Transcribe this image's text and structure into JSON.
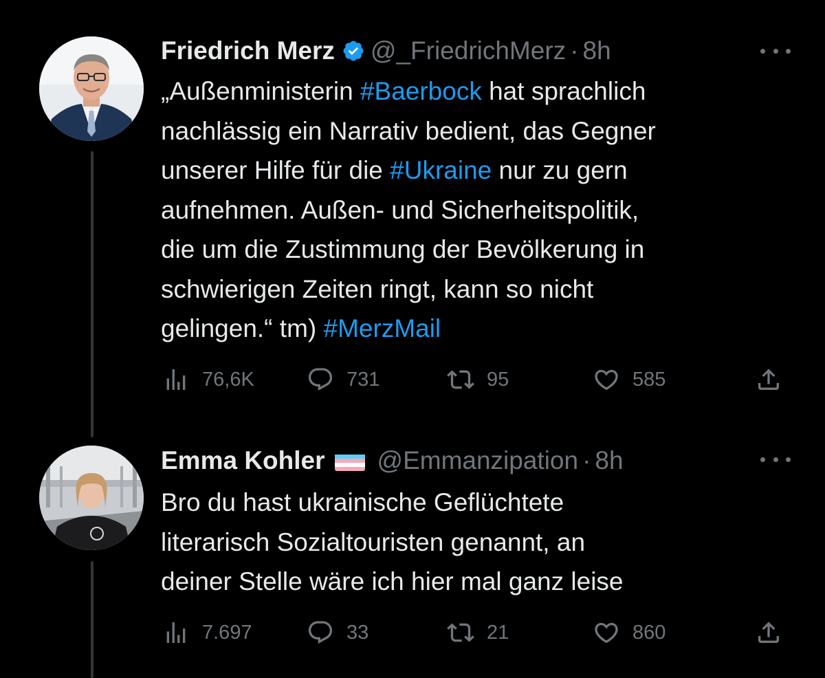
{
  "tweets": [
    {
      "author": {
        "name": "Friedrich Merz",
        "handle": "@_FriedrichMerz",
        "verified": true
      },
      "time": "8h",
      "text_lines": [
        [
          {
            "t": "„Außenministerin "
          },
          {
            "t": "#Baerbock",
            "tag": true
          },
          {
            "t": " hat sprachlich"
          }
        ],
        [
          {
            "t": "nachlässig ein Narrativ bedient, das Gegner"
          }
        ],
        [
          {
            "t": "unserer Hilfe für die "
          },
          {
            "t": "#Ukraine",
            "tag": true
          },
          {
            "t": " nur zu gern"
          }
        ],
        [
          {
            "t": "aufnehmen. Außen- und Sicherheitspolitik,"
          }
        ],
        [
          {
            "t": "die um die Zustimmung der Bevölkerung in"
          }
        ],
        [
          {
            "t": "schwierigen Zeiten ringt, kann so nicht"
          }
        ],
        [
          {
            "t": "gelingen.“ tm) "
          },
          {
            "t": "#MerzMail",
            "tag": true
          }
        ]
      ],
      "stats": {
        "views": "76,6K",
        "replies": "731",
        "retweets": "95",
        "likes": "585"
      }
    },
    {
      "author": {
        "name": "Emma Kohler",
        "handle": "@Emmanzipation",
        "flag": "transgender-flag"
      },
      "time": "8h",
      "text_lines": [
        [
          {
            "t": "Bro du hast ukrainische Geflüchtete"
          }
        ],
        [
          {
            "t": "literarisch Sozialtouristen genannt, an"
          }
        ],
        [
          {
            "t": "deiner Stelle wäre ich hier mal ganz leise"
          }
        ]
      ],
      "stats": {
        "views": "7.697",
        "replies": "33",
        "retweets": "21",
        "likes": "860"
      }
    }
  ],
  "separator": "·",
  "icons": {
    "views": "views-icon",
    "reply": "reply-icon",
    "retweet": "retweet-icon",
    "like": "like-icon",
    "share": "share-icon",
    "more": "more-icon",
    "verified": "verified-badge-icon"
  },
  "colors": {
    "background": "#000000",
    "text": "#e7e9ea",
    "muted": "#71767b",
    "hashtag": "#1d9bf0",
    "verified": "#1d9bf0",
    "thread_line": "#333639"
  }
}
